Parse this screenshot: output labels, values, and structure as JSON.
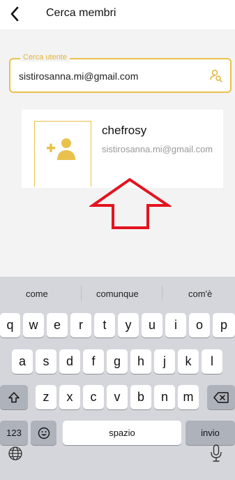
{
  "header": {
    "title": "Cerca membri"
  },
  "search": {
    "label": "Cerca utente",
    "value": "sistirosanna.mi@gmail.com"
  },
  "result": {
    "name": "chefrosy",
    "email": "sistirosanna.mi@gmail.com"
  },
  "keyboard": {
    "suggestions": [
      "come",
      "comunque",
      "com'è"
    ],
    "row1": [
      "q",
      "w",
      "e",
      "r",
      "t",
      "y",
      "u",
      "i",
      "o",
      "p"
    ],
    "row2": [
      "a",
      "s",
      "d",
      "f",
      "g",
      "h",
      "j",
      "k",
      "l"
    ],
    "row3": [
      "z",
      "x",
      "c",
      "v",
      "b",
      "n",
      "m"
    ],
    "numbers_label": "123",
    "space_label": "spazio",
    "return_label": "invio"
  },
  "colors": {
    "accent": "#e9c14d",
    "annotation": "#e3141f",
    "keyboard_bg": "#d4d6db"
  },
  "icons": [
    "back-arrow-icon",
    "user-search-icon",
    "add-user-icon",
    "up-arrow-annotation",
    "shift-icon",
    "backspace-icon",
    "emoji-icon",
    "globe-icon",
    "mic-icon"
  ]
}
